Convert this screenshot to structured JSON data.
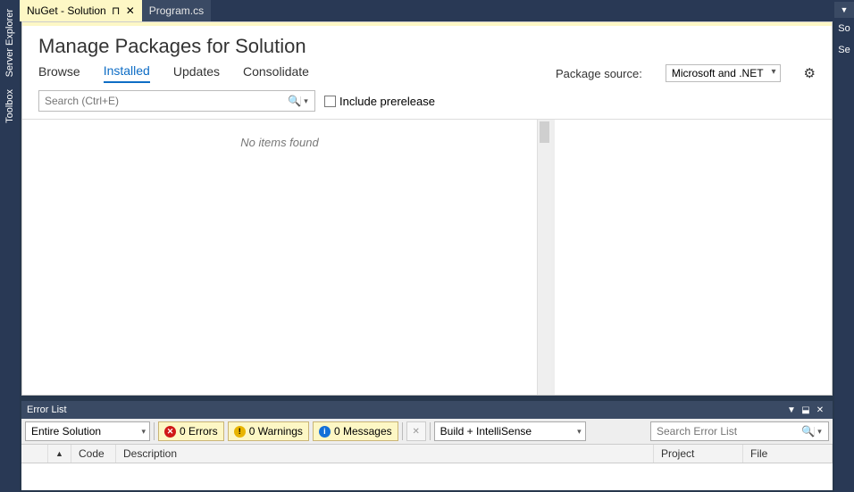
{
  "side_tabs": {
    "server_explorer": "Server Explorer",
    "toolbox": "Toolbox"
  },
  "tabs": {
    "active": "NuGet - Solution",
    "inactive": "Program.cs"
  },
  "page_title": "Manage Packages for Solution",
  "nav": {
    "browse": "Browse",
    "installed": "Installed",
    "updates": "Updates",
    "consolidate": "Consolidate"
  },
  "pkg_source": {
    "label": "Package source:",
    "value": "Microsoft and .NET"
  },
  "search": {
    "placeholder": "Search (Ctrl+E)"
  },
  "prerelease": {
    "label": "Include prerelease",
    "checked": false
  },
  "results": {
    "empty": "No items found"
  },
  "error_list": {
    "title": "Error List",
    "scope": "Entire Solution",
    "errors": "0 Errors",
    "warnings": "0 Warnings",
    "messages": "0 Messages",
    "filter": "Build + IntelliSense",
    "search_placeholder": "Search Error List",
    "cols": {
      "code": "Code",
      "description": "Description",
      "project": "Project",
      "file": "File"
    }
  },
  "right": {
    "se": "Se",
    "so": "So"
  }
}
